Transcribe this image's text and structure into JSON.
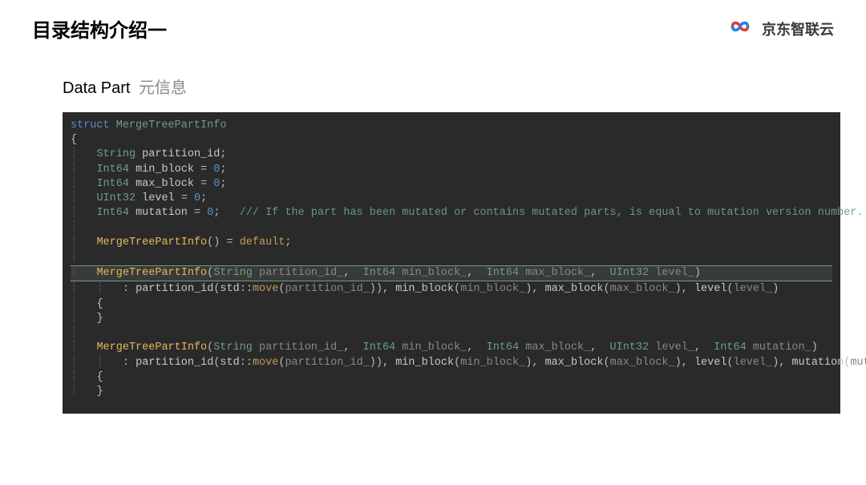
{
  "header": {
    "title": "目录结构介绍一",
    "brand_text": "京东智联云"
  },
  "subtitle": {
    "main": "Data Part",
    "sub": "元信息"
  },
  "code": {
    "tokens": {
      "struct": "struct",
      "name": "MergeTreePartInfo",
      "String": "String",
      "Int64": "Int64",
      "UInt32": "UInt32",
      "partition_id": "partition_id",
      "min_block": "min_block",
      "max_block": "max_block",
      "level": "level",
      "mutation": "mutation",
      "zero": "0",
      "default": "default",
      "std_move": "std",
      "move": "move",
      "partition_idp": "partition_id_",
      "min_blockp": "min_block_",
      "max_blockp": "max_block_",
      "levelp": "level_",
      "mutationp": "mutation_",
      "comment": "/// If the part has been mutated or contains mutated parts, is equal to mutation version number."
    }
  }
}
